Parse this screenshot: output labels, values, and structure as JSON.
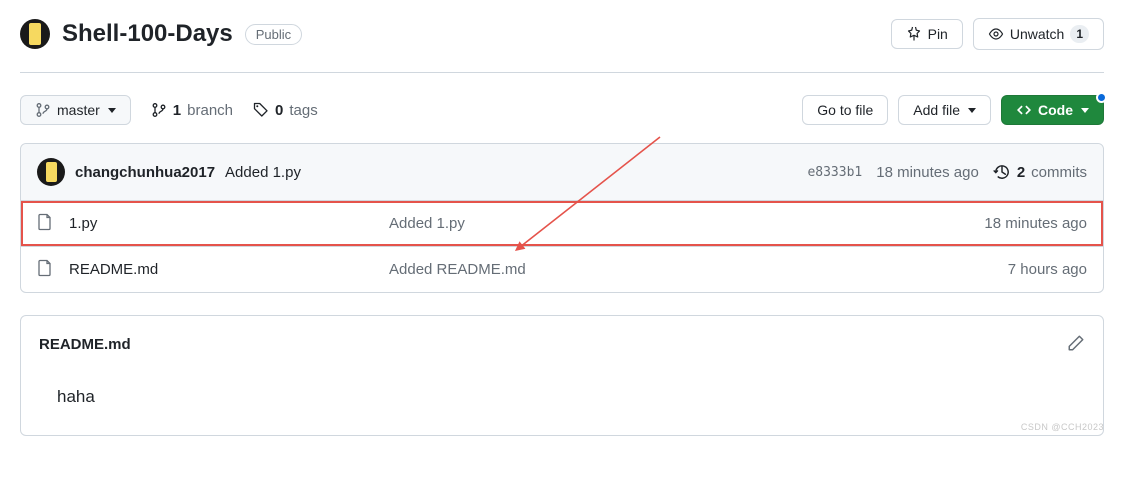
{
  "repo": {
    "name": "Shell-100-Days",
    "visibility": "Public"
  },
  "headActions": {
    "pin": "Pin",
    "unwatch": "Unwatch",
    "unwatchCount": "1"
  },
  "branch": {
    "selected": "master"
  },
  "stats": {
    "branchCount": "1",
    "branchLabel": "branch",
    "tagCount": "0",
    "tagLabel": "tags"
  },
  "actions": {
    "goToFile": "Go to file",
    "addFile": "Add file",
    "code": "Code"
  },
  "commit": {
    "author": "changchunhua2017",
    "message": "Added 1.py",
    "sha": "e8333b1",
    "time": "18 minutes ago",
    "commitsCount": "2",
    "commitsLabel": "commits"
  },
  "files": [
    {
      "name": "1.py",
      "message": "Added 1.py",
      "time": "18 minutes ago",
      "highlight": true
    },
    {
      "name": "README.md",
      "message": "Added README.md",
      "time": "7 hours ago",
      "highlight": false
    }
  ],
  "readme": {
    "title": "README.md",
    "body": "haha"
  },
  "watermark": "CSDN @CCH2023"
}
